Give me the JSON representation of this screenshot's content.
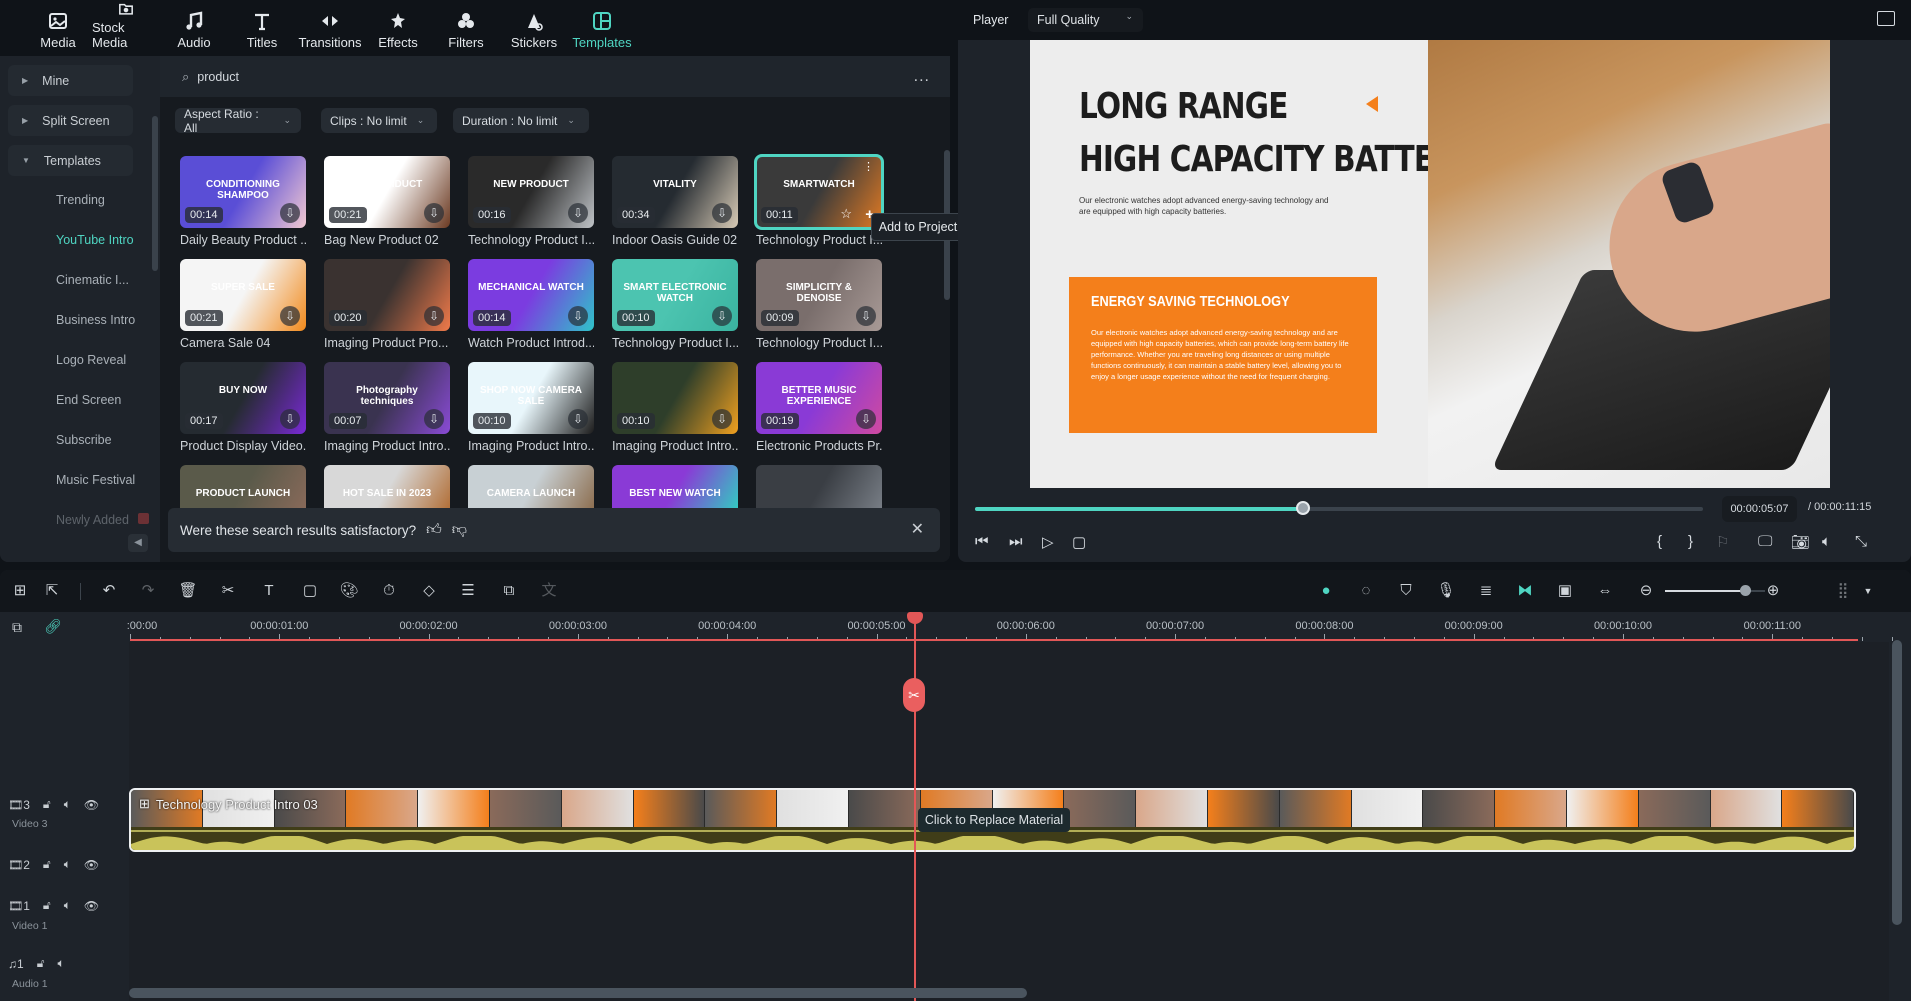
{
  "nav": {
    "items": [
      {
        "label": "Media",
        "icon": "media-icon"
      },
      {
        "label": "Stock Media",
        "icon": "stock-media-icon"
      },
      {
        "label": "Audio",
        "icon": "music-note-icon"
      },
      {
        "label": "Titles",
        "icon": "titles-icon"
      },
      {
        "label": "Transitions",
        "icon": "transitions-icon"
      },
      {
        "label": "Effects",
        "icon": "effects-icon"
      },
      {
        "label": "Filters",
        "icon": "filters-icon"
      },
      {
        "label": "Stickers",
        "icon": "stickers-icon"
      },
      {
        "label": "Templates",
        "icon": "templates-icon",
        "active": true
      }
    ]
  },
  "sidebar": {
    "groups": [
      {
        "label": "Mine",
        "expanded": false
      },
      {
        "label": "Split Screen",
        "expanded": false
      },
      {
        "label": "Templates",
        "expanded": true
      }
    ],
    "items": [
      {
        "label": "Trending"
      },
      {
        "label": "YouTube Intro",
        "active": true
      },
      {
        "label": "Cinematic I..."
      },
      {
        "label": "Business Intro"
      },
      {
        "label": "Logo Reveal"
      },
      {
        "label": "End Screen"
      },
      {
        "label": "Subscribe"
      },
      {
        "label": "Music Festival"
      },
      {
        "label": "Newly Added"
      }
    ]
  },
  "search": {
    "value": "product",
    "more": "..."
  },
  "filters": [
    {
      "label": "Aspect Ratio : All"
    },
    {
      "label": "Clips : No limit"
    },
    {
      "label": "Duration : No limit"
    }
  ],
  "templates": [
    {
      "name": "Daily Beauty Product ...",
      "duration": "00:14",
      "text": "CONDITIONING SHAMPOO",
      "bg": "#5a4ed6",
      "bg2": "#f2c9d2"
    },
    {
      "name": "Bag New Product 02",
      "duration": "00:21",
      "text": "NEW PRIDUCT",
      "bg": "#ffffff",
      "bg2": "#6b3a22"
    },
    {
      "name": "Technology Product I...",
      "duration": "00:16",
      "text": "NEW PRODUCT",
      "bg": "#2a2a2a",
      "bg2": "#bfc3c7"
    },
    {
      "name": "Indoor Oasis Guide 02",
      "duration": "00:34",
      "text": "VITALITY",
      "bg": "#252b31",
      "bg2": "#d8cbb6"
    },
    {
      "name": "Technology Product I...",
      "duration": "00:11",
      "text": "SMARTWATCH",
      "bg": "#3a3a3a",
      "bg2": "#e07a24",
      "selected": true
    },
    {
      "name": "Camera Sale 04",
      "duration": "00:21",
      "text": "SUPER SALE",
      "bg": "#f5f5f5",
      "bg2": "#f28a1c"
    },
    {
      "name": "Imaging Product Pro...",
      "duration": "00:20",
      "text": "",
      "bg": "#3a3230",
      "bg2": "#f07a4a"
    },
    {
      "name": "Watch Product Introd...",
      "duration": "00:14",
      "text": "MECHANICAL WATCH",
      "bg": "#7b3ce0",
      "bg2": "#2fc4c9"
    },
    {
      "name": "Technology Product I...",
      "duration": "00:10",
      "text": "SMART ELECTRONIC WATCH",
      "bg": "#4cc4b0",
      "bg2": "#3ab3a0"
    },
    {
      "name": "Technology Product I...",
      "duration": "00:09",
      "text": "SIMPLICITY & DENOISE",
      "bg": "#7a6e6c",
      "bg2": "#a89a96"
    },
    {
      "name": "Product Display Video...",
      "duration": "00:17",
      "text": "BUY NOW",
      "bg": "#252b31",
      "bg2": "#7a2ad6"
    },
    {
      "name": "Imaging Product Intro...",
      "duration": "00:07",
      "text": "Photography techniques",
      "bg": "#3a3350",
      "bg2": "#8a4bd6"
    },
    {
      "name": "Imaging Product Intro...",
      "duration": "00:10",
      "text": "SHOP NOW CAMERA SALE",
      "bg": "#e8f6fb",
      "bg2": "#1c1c1c"
    },
    {
      "name": "Imaging Product Intro...",
      "duration": "00:10",
      "text": "",
      "bg": "#2e3e2a",
      "bg2": "#f0a020"
    },
    {
      "name": "Electronic Products Pr...",
      "duration": "00:19",
      "text": "BETTER MUSIC EXPERIENCE",
      "bg": "#8a3ad6",
      "bg2": "#d04aa0"
    },
    {
      "name": "",
      "duration": "",
      "text": "PRODUCT LAUNCH",
      "bg": "#5a5a4a",
      "bg2": "#8a6a5a"
    },
    {
      "name": "",
      "duration": "",
      "text": "HOT SALE IN 2023",
      "bg": "#d8d8d8",
      "bg2": "#b06a30"
    },
    {
      "name": "",
      "duration": "",
      "text": "CAMERA LAUNCH",
      "bg": "#c8d0d4",
      "bg2": "#8a6a4a"
    },
    {
      "name": "",
      "duration": "",
      "text": "BEST NEW WATCH",
      "bg": "#8a3ad6",
      "bg2": "#2fd0c0"
    },
    {
      "name": "",
      "duration": "",
      "text": "",
      "bg": "#3a3e44",
      "bg2": "#7a8088"
    }
  ],
  "tooltip": {
    "add_to_project": "Add to Project"
  },
  "feedback": {
    "question": "Were these search results satisfactory?",
    "close": "✕"
  },
  "player": {
    "label": "Player",
    "quality": "Full Quality",
    "preview": {
      "title_line1": "LONG RANGE",
      "title_line2": "HIGH CAPACITY BATTERY",
      "subtitle": "Our electronic watches adopt advanced energy-saving technology and are equipped with high capacity batteries.",
      "box_heading": "ENERGY SAVING TECHNOLOGY",
      "box_text": "Our electronic watches adopt advanced energy-saving technology and are equipped with high capacity batteries, which can provide long-term battery life performance. Whether you are traveling long distances or using multiple functions continuously, it can maintain a stable battery level, allowing you to enjoy a longer usage experience without the need for frequent charging.",
      "accent": "#f47f1b"
    },
    "current_time": "00:00:05:07",
    "total_time": "/ 00:00:11:15",
    "progress": 0.45,
    "accent": "#4fd5c2"
  },
  "timeline": {
    "ruler_labels": [
      ":00:00",
      "00:00:01:00",
      "00:00:02:00",
      "00:00:03:00",
      "00:00:04:00",
      "00:00:05:00",
      "00:00:06:00",
      "00:00:07:00",
      "00:00:08:00",
      "00:00:09:00",
      "00:00:10:00",
      "00:00:11:00"
    ],
    "tracks": [
      {
        "number": "3",
        "label": "Video 3",
        "type": "video"
      },
      {
        "number": "2",
        "label": "",
        "type": "video"
      },
      {
        "number": "1",
        "label": "Video 1",
        "type": "video"
      },
      {
        "number": "1",
        "label": "Audio 1",
        "type": "audio"
      }
    ],
    "clip_title": "Technology Product Intro 03",
    "replace_tooltip": "Click to Replace Material",
    "zoom_level": 0.8,
    "playhead_color": "#e25757"
  }
}
